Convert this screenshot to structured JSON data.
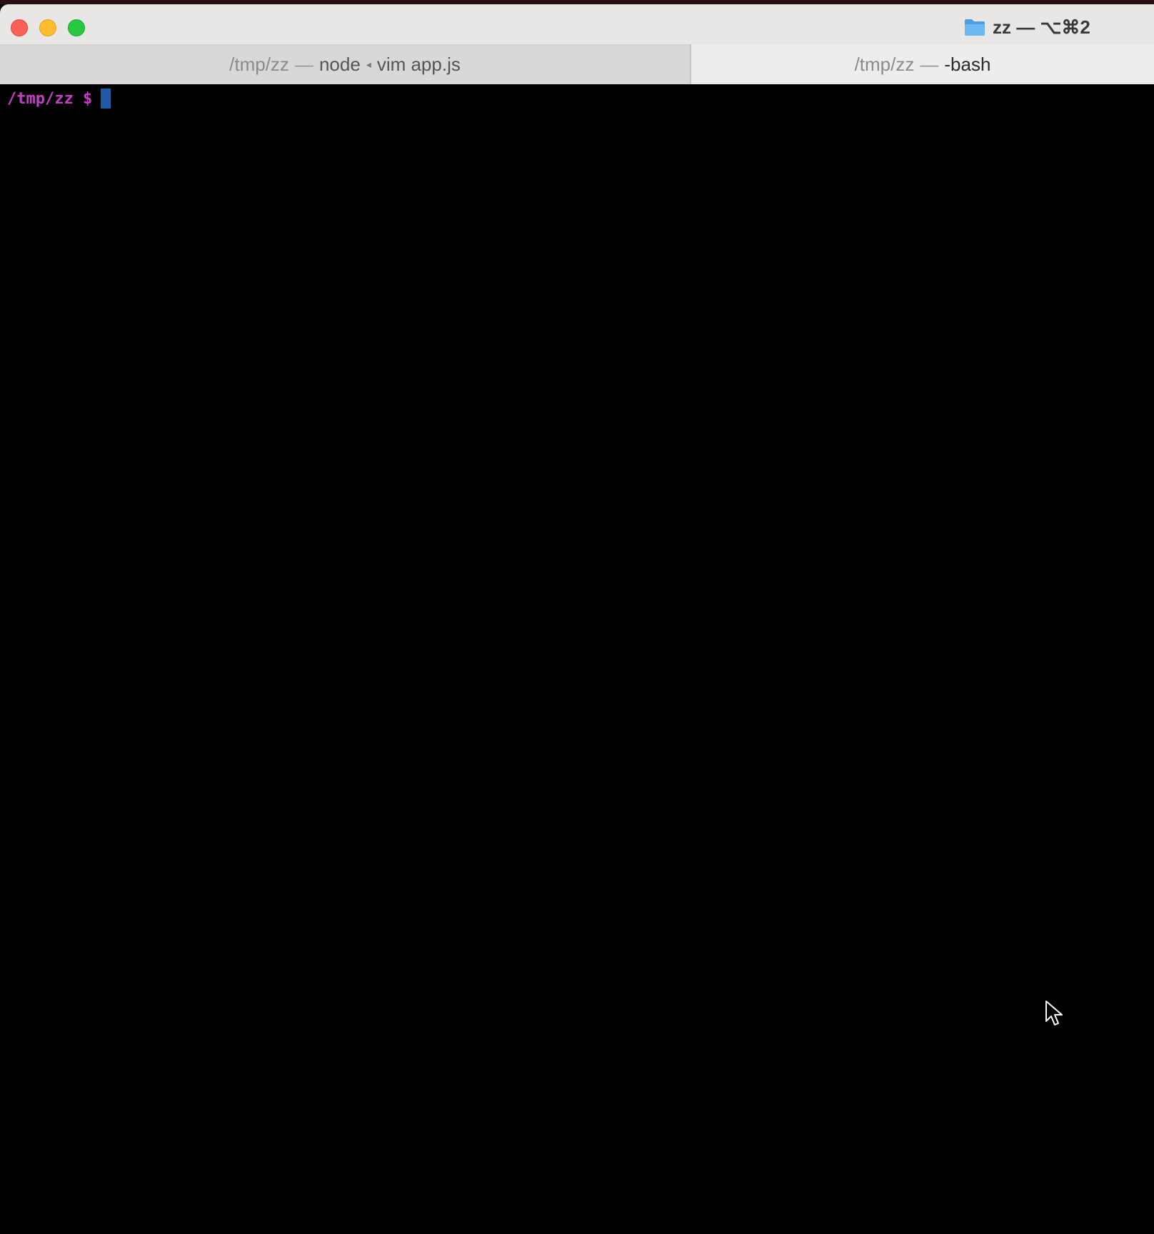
{
  "window": {
    "title": "zz — ⌥⌘2",
    "folder_icon": "folder-icon"
  },
  "tabs": [
    {
      "dir": "/tmp/zz",
      "sep": "—",
      "proc1": "node",
      "arrow": "◂",
      "proc2": "vim app.js",
      "active": false
    },
    {
      "dir": "/tmp/zz",
      "sep": "—",
      "proc1": "-bash",
      "active": true
    }
  ],
  "terminal": {
    "prompt": "/tmp/zz $",
    "prompt_color": "#c33fc5",
    "cursor_color": "#1f5aa6",
    "background": "#000000"
  },
  "colors": {
    "close": "#fe5f57",
    "minimize": "#febc2e",
    "zoom": "#28c840",
    "folder": "#5aa9e6"
  }
}
